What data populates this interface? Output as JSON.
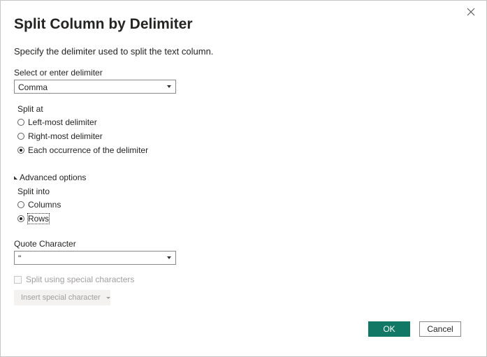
{
  "dialog": {
    "title": "Split Column by Delimiter",
    "description": "Specify the delimiter used to split the text column."
  },
  "delimiter": {
    "label": "Select or enter delimiter",
    "value": "Comma"
  },
  "split_at": {
    "label": "Split at",
    "options": [
      {
        "label": "Left-most delimiter",
        "checked": false
      },
      {
        "label": "Right-most delimiter",
        "checked": false
      },
      {
        "label": "Each occurrence of the delimiter",
        "checked": true
      }
    ]
  },
  "advanced": {
    "toggle_label": "Advanced options",
    "split_into_label": "Split into",
    "split_into_options": [
      {
        "label": "Columns",
        "checked": false
      },
      {
        "label": "Rows",
        "checked": true
      }
    ],
    "quote_label": "Quote Character",
    "quote_value": "\"",
    "special_chars_label": "Split using special characters",
    "insert_special_label": "Insert special character"
  },
  "buttons": {
    "ok": "OK",
    "cancel": "Cancel"
  },
  "colors": {
    "primary": "#117865"
  }
}
